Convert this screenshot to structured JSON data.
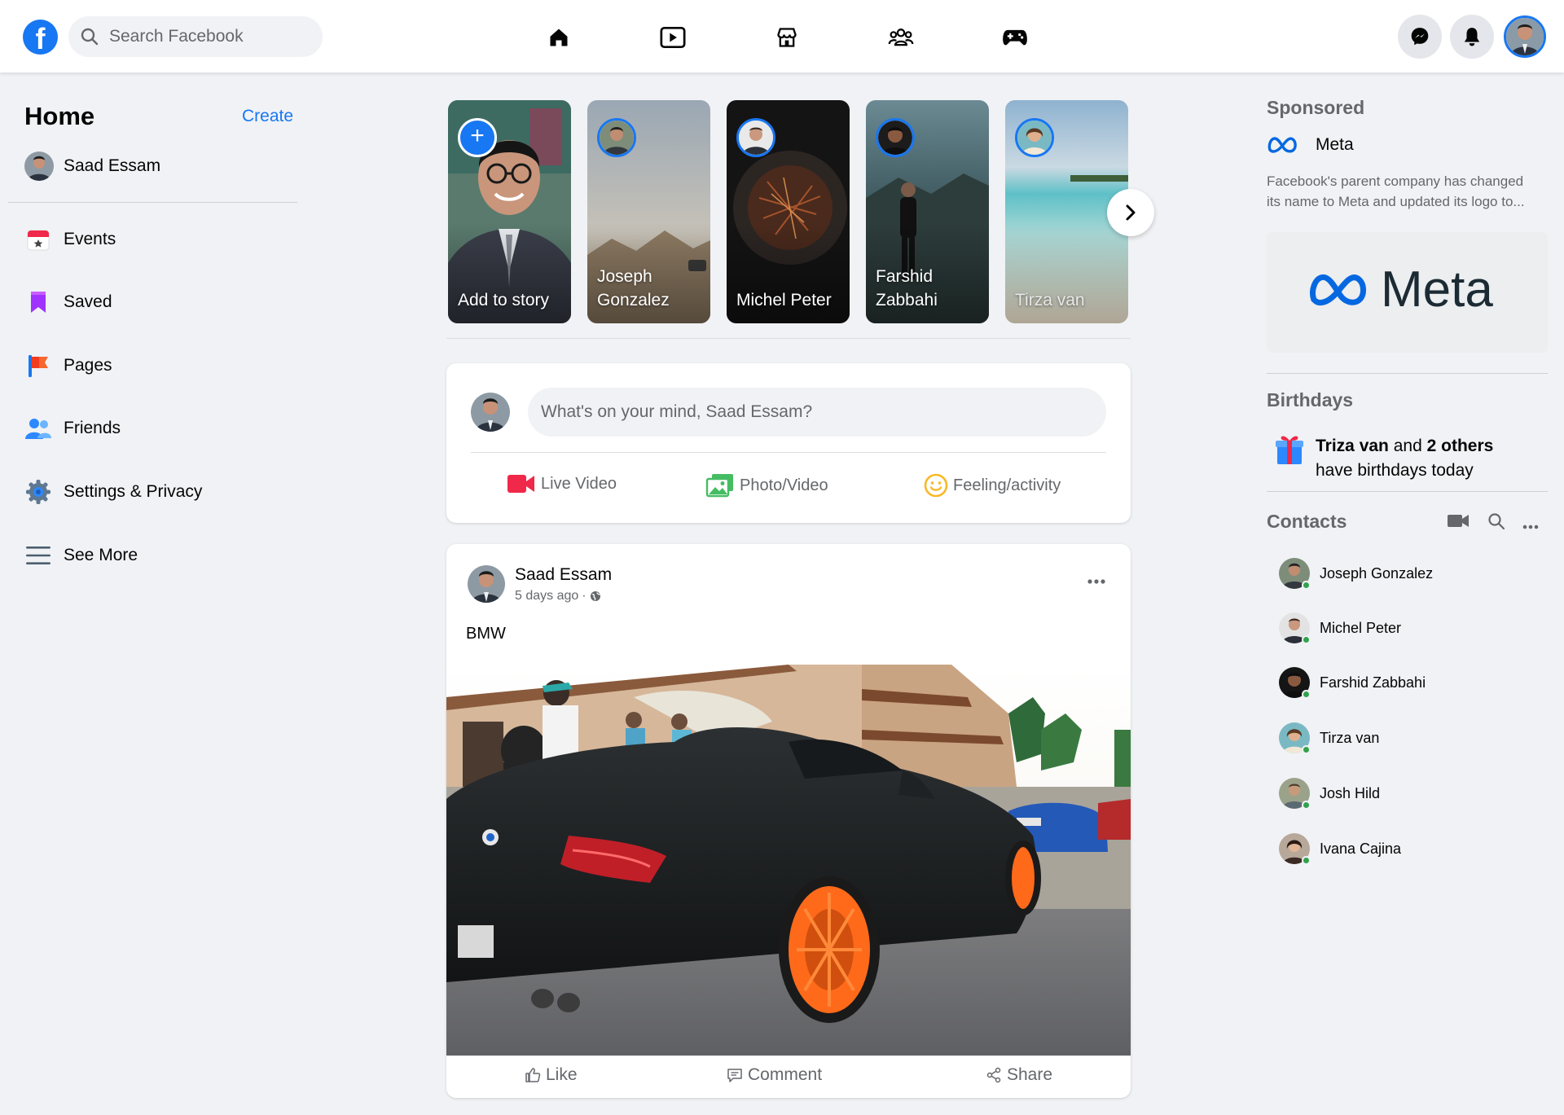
{
  "topbar": {
    "logo_letter": "f",
    "search_placeholder": "Search Facebook",
    "nav": [
      "home-icon",
      "watch-icon",
      "marketplace-icon",
      "groups-icon",
      "gaming-icon"
    ],
    "right": [
      "messenger-icon",
      "notifications-icon",
      "profile-avatar"
    ]
  },
  "left": {
    "title": "Home",
    "create": "Create",
    "user_name": "Saad Essam",
    "items": [
      {
        "label": "Events",
        "icon": "calendar-icon"
      },
      {
        "label": "Saved",
        "icon": "bookmark-icon"
      },
      {
        "label": "Pages",
        "icon": "flag-icon"
      },
      {
        "label": "Friends",
        "icon": "friends-icon"
      },
      {
        "label": "Settings & Privacy",
        "icon": "gear-icon"
      },
      {
        "label": "See More",
        "icon": "menu-icon"
      }
    ]
  },
  "stories": [
    {
      "name": "Add to story"
    },
    {
      "name": "Joseph Gonzalez"
    },
    {
      "name": "Michel Peter"
    },
    {
      "name": "Farshid Zabbahi"
    },
    {
      "name": "Tirza van"
    }
  ],
  "composer": {
    "placeholder": "What's on your mind, Saad Essam?",
    "actions": [
      "Live Video",
      "Photo/Video",
      "Feeling/activity"
    ]
  },
  "post": {
    "author": "Saad Essam",
    "time": "5 days ago",
    "text": "BMW",
    "actions": [
      "Like",
      "Comment",
      "Share"
    ]
  },
  "right": {
    "sponsored_heading": "Sponsored",
    "sponsor_name": "Meta",
    "sponsor_text": "Facebook's parent company has changed its name to Meta and updated its logo to...",
    "ad_logo_text": "Meta",
    "birthdays_heading": "Birthdays",
    "birthday_name": "Triza van",
    "birthday_and": "and",
    "birthday_others": "2 others",
    "birthday_suffix": "have birthdays today",
    "contacts_heading": "Contacts",
    "contacts": [
      "Joseph Gonzalez",
      "Michel Peter",
      "Farshid Zabbahi",
      "Tirza van",
      "Josh Hild",
      "Ivana Cajina"
    ]
  },
  "colors": {
    "brand": "#1877f2",
    "online": "#31a24c",
    "background": "#f0f2f5"
  }
}
